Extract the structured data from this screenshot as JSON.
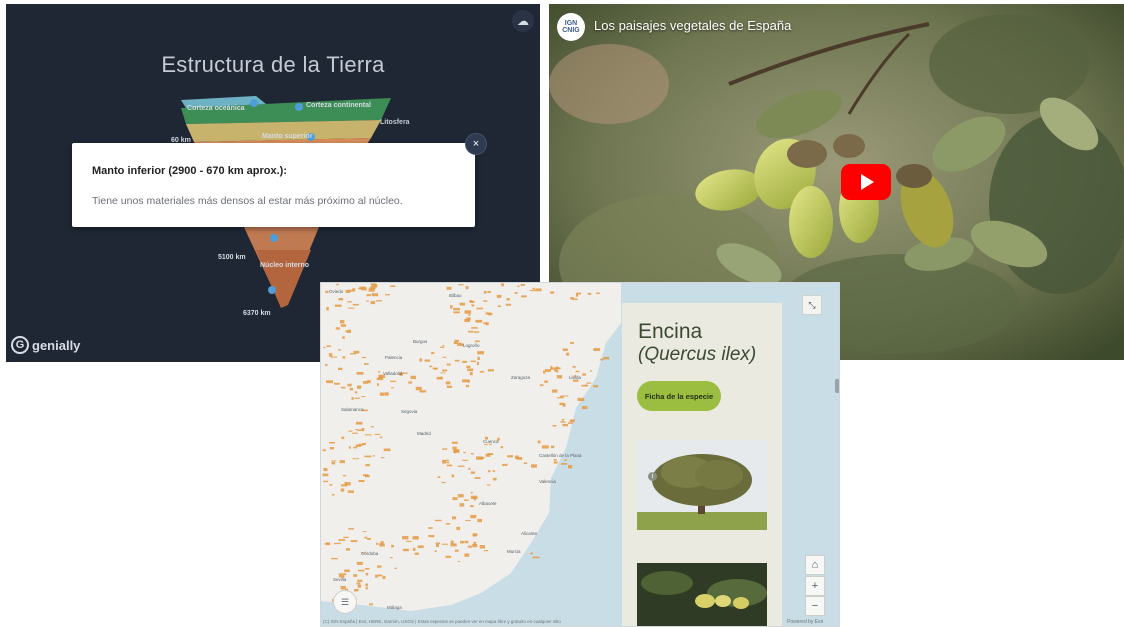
{
  "genially": {
    "title": "Estructura de la Tierra",
    "layer_labels": [
      "Corteza oceánica",
      "Corteza continental",
      "Litosfera",
      "Manto superior",
      "Núcleo interno"
    ],
    "depth_labels": [
      "60 km",
      "5100 km",
      "6370 km"
    ],
    "popup": {
      "title": "Manto inferior (2900 - 670 km aprox.):",
      "body": "Tiene unos materiales más densos al estar más próximo al núcleo.",
      "close_glyph": "×"
    },
    "brand": "genially",
    "brand_glyph": "G",
    "icon": "cloud-settings-icon"
  },
  "youtube": {
    "channel_logo_top": "IGN",
    "channel_logo_bottom": "CNIG",
    "title": "Los paisajes vegetales de España",
    "icon": "youtube-play-icon"
  },
  "map": {
    "species_common": "Encina",
    "species_scientific": "(Quercus ilex)",
    "ficha_button": "Ficha de la especie",
    "info_glyph": "i",
    "zoom_in": "+",
    "zoom_out": "−",
    "home_glyph": "⌂",
    "places": [
      "Oviedo",
      "Bilbao",
      "Burgos",
      "Logroño",
      "Palencia",
      "Valladolid",
      "Zaragoza",
      "Lleida",
      "Salamanca",
      "Segovia",
      "Madrid",
      "Cuenca",
      "Castellón de la Plana",
      "Valencia",
      "Albacete",
      "Alicante",
      "Murcia",
      "Córdoba",
      "Sevilla",
      "Málaga"
    ],
    "attribution": "(C) IGN España | Esri, HERE, Garmin, USGS | Estas especies se pueden ver en mapa libre y gratuito en cualquier sitio",
    "powered_by": "Powered by Esri"
  },
  "colors": {
    "genially_bg": "#1f2735",
    "map_sea": "#c9dde6",
    "distribution": "#e59a44",
    "ficha_green": "#9bbd40",
    "youtube_red": "#ff0000"
  }
}
